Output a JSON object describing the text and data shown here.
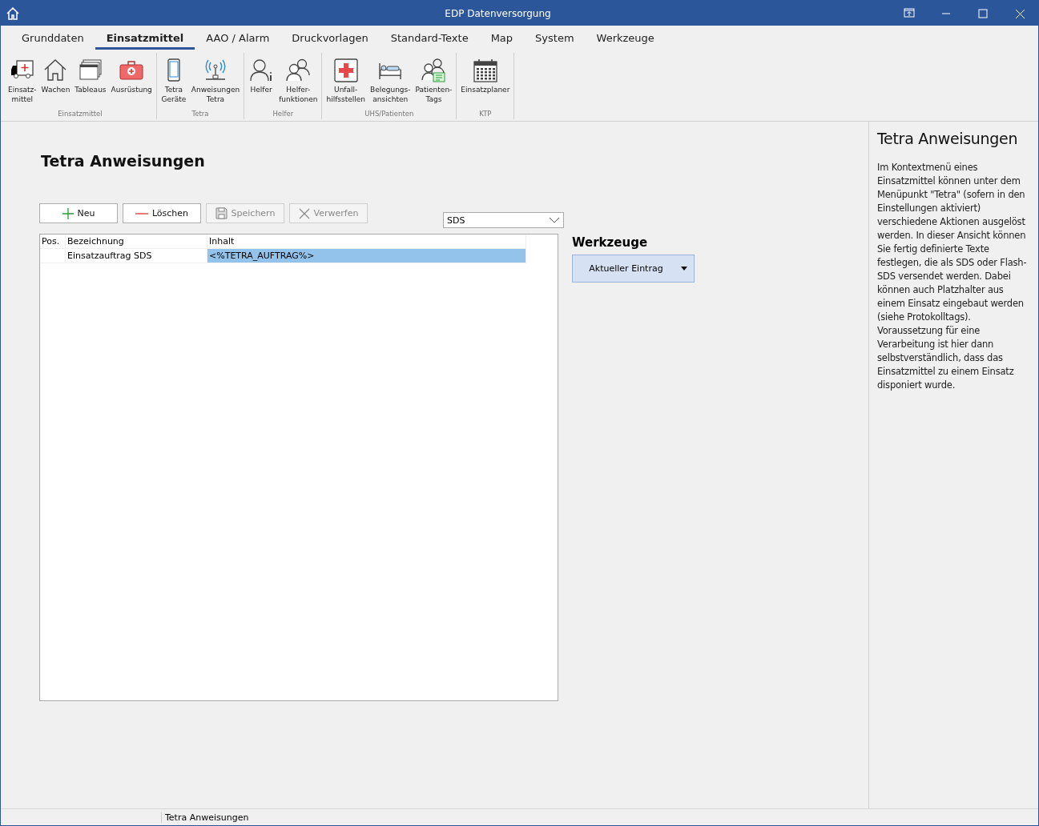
{
  "window": {
    "title": "EDP Datenversorgung"
  },
  "tabs": [
    {
      "label": "Grunddaten",
      "selected": false
    },
    {
      "label": "Einsatzmittel",
      "selected": true
    },
    {
      "label": "AAO / Alarm",
      "selected": false
    },
    {
      "label": "Druckvorlagen",
      "selected": false
    },
    {
      "label": "Standard-Texte",
      "selected": false
    },
    {
      "label": "Map",
      "selected": false
    },
    {
      "label": "System",
      "selected": false
    },
    {
      "label": "Werkzeuge",
      "selected": false
    }
  ],
  "ribbon_groups": [
    {
      "label": "Einsatzmittel",
      "items": [
        {
          "label": "Einsatz-\nmittel",
          "kind": "ambulance"
        },
        {
          "label": "Wachen",
          "kind": "house"
        },
        {
          "label": "Tableaus",
          "kind": "windows"
        },
        {
          "label": "Ausrüstung",
          "kind": "kit"
        }
      ]
    },
    {
      "label": "Tetra",
      "items": [
        {
          "label": "Tetra\nGeräte",
          "kind": "phone"
        },
        {
          "label": "Anweisungen\nTetra",
          "kind": "antenna"
        }
      ]
    },
    {
      "label": "Helfer",
      "items": [
        {
          "label": "Helfer",
          "kind": "person"
        },
        {
          "label": "Helfer-\nfunktionen",
          "kind": "people"
        }
      ]
    },
    {
      "label": "UHS/Patienten",
      "items": [
        {
          "label": "Unfall-\nhilfsstellen",
          "kind": "cross"
        },
        {
          "label": "Belegungs-\nansichten",
          "kind": "bed"
        },
        {
          "label": "Patienten-\nTags",
          "kind": "tag"
        }
      ]
    },
    {
      "label": "KTP",
      "items": [
        {
          "label": "Einsatzplaner",
          "kind": "calendar"
        }
      ]
    }
  ],
  "page": {
    "title": "Tetra Anweisungen",
    "buttons": [
      {
        "label": "Neu",
        "kind": "add",
        "disabled": false
      },
      {
        "label": "Löschen",
        "kind": "delete",
        "disabled": false
      },
      {
        "label": "Speichern",
        "kind": "save",
        "disabled": true
      },
      {
        "label": "Verwerfen",
        "kind": "discard",
        "disabled": true
      }
    ],
    "type_select": {
      "value": "SDS"
    },
    "table": {
      "columns": [
        "Pos.",
        "Bezeichnung",
        "Inhalt"
      ],
      "rows": [
        {
          "cells": [
            "",
            "Einsatzauftrag SDS",
            "<%TETRA_AUFTRAG%>"
          ],
          "selected": true
        }
      ]
    },
    "tools": {
      "title": "Werkzeuge",
      "button": "Aktueller Eintrag"
    }
  },
  "help": {
    "title": "Tetra Anweisungen",
    "text": "Im Kontextmenü eines Einsatzmittel können unter dem Menüpunkt \"Tetra\" (sofern in den Einstellungen aktiviert) verschiedene Aktionen ausgelöst werden. In dieser Ansicht können Sie fertig definierte Texte festlegen, die als SDS oder Flash-SDS versendet werden. Dabei können auch Platzhalter aus einem Einsatz eingebaut werden (siehe Protokolltags). Voraussetzung für eine Verarbeitung ist hier dann selbstverständlich, dass das Einsatzmittel zu einem Einsatz disponiert wurde."
  },
  "status_bar": {
    "text": "Tetra Anweisungen"
  }
}
